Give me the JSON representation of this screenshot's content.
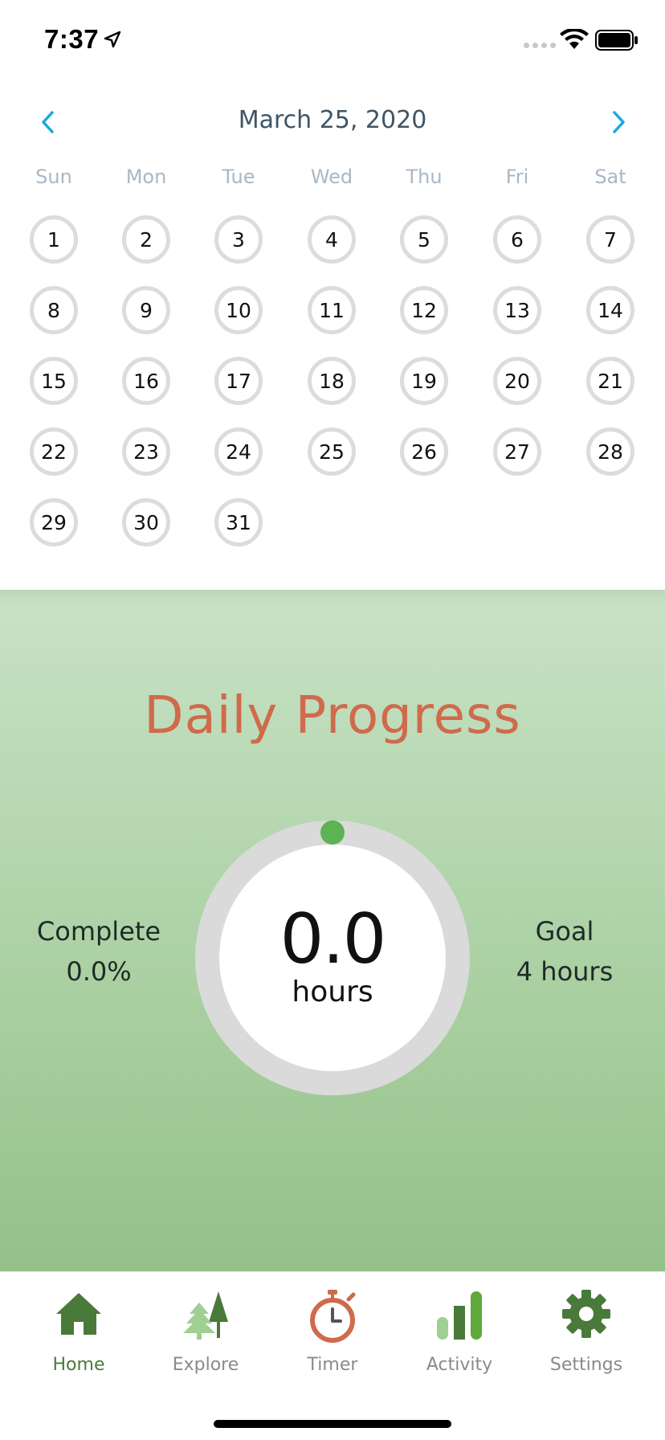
{
  "status_bar": {
    "time": "7:37"
  },
  "calendar": {
    "title": "March 25, 2020",
    "weekdays": [
      "Sun",
      "Mon",
      "Tue",
      "Wed",
      "Thu",
      "Fri",
      "Sat"
    ],
    "days": [
      "1",
      "2",
      "3",
      "4",
      "5",
      "6",
      "7",
      "8",
      "9",
      "10",
      "11",
      "12",
      "13",
      "14",
      "15",
      "16",
      "17",
      "18",
      "19",
      "20",
      "21",
      "22",
      "23",
      "24",
      "25",
      "26",
      "27",
      "28",
      "29",
      "30",
      "31"
    ]
  },
  "progress": {
    "title": "Daily Progress",
    "hours_value": "0.0",
    "hours_unit": "hours",
    "complete_label": "Complete",
    "complete_value": "0.0%",
    "goal_label": "Goal",
    "goal_value": "4 hours",
    "fraction": 0.0
  },
  "tabs": [
    {
      "label": "Home",
      "icon": "home-icon",
      "active": true
    },
    {
      "label": "Explore",
      "icon": "trees-icon",
      "active": false
    },
    {
      "label": "Timer",
      "icon": "stopwatch-icon",
      "active": false
    },
    {
      "label": "Activity",
      "icon": "bar-chart-icon",
      "active": false
    },
    {
      "label": "Settings",
      "icon": "gear-icon",
      "active": false
    }
  ],
  "colors": {
    "accent_blue": "#1aa8e0",
    "title_orange": "#d06a4c",
    "tab_active_green": "#4a7a3a",
    "progress_dot": "#5cb354"
  }
}
